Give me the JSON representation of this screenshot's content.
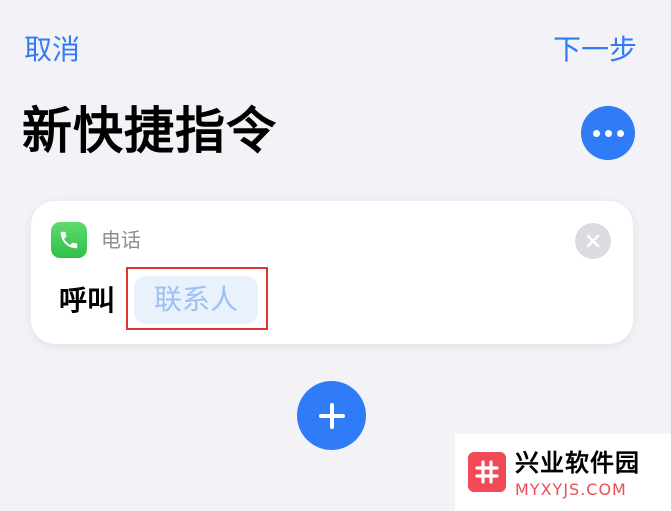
{
  "nav": {
    "cancel_label": "取消",
    "next_label": "下一步"
  },
  "title": "新快捷指令",
  "more_button": {
    "icon": "more-icon"
  },
  "action_card": {
    "app_label": "电话",
    "app_icon": "phone-icon",
    "action_text": "呼叫",
    "contact_placeholder": "联系人",
    "close_icon": "close-icon"
  },
  "add_button": {
    "icon": "plus-icon"
  },
  "watermark": {
    "name": "兴业软件园",
    "domain": "MYXYJS.COM",
    "logo": "hash-icon"
  },
  "colors": {
    "accent": "#2f7cf6",
    "highlight": "#e0352f",
    "watermark_red": "#ef4a55"
  }
}
